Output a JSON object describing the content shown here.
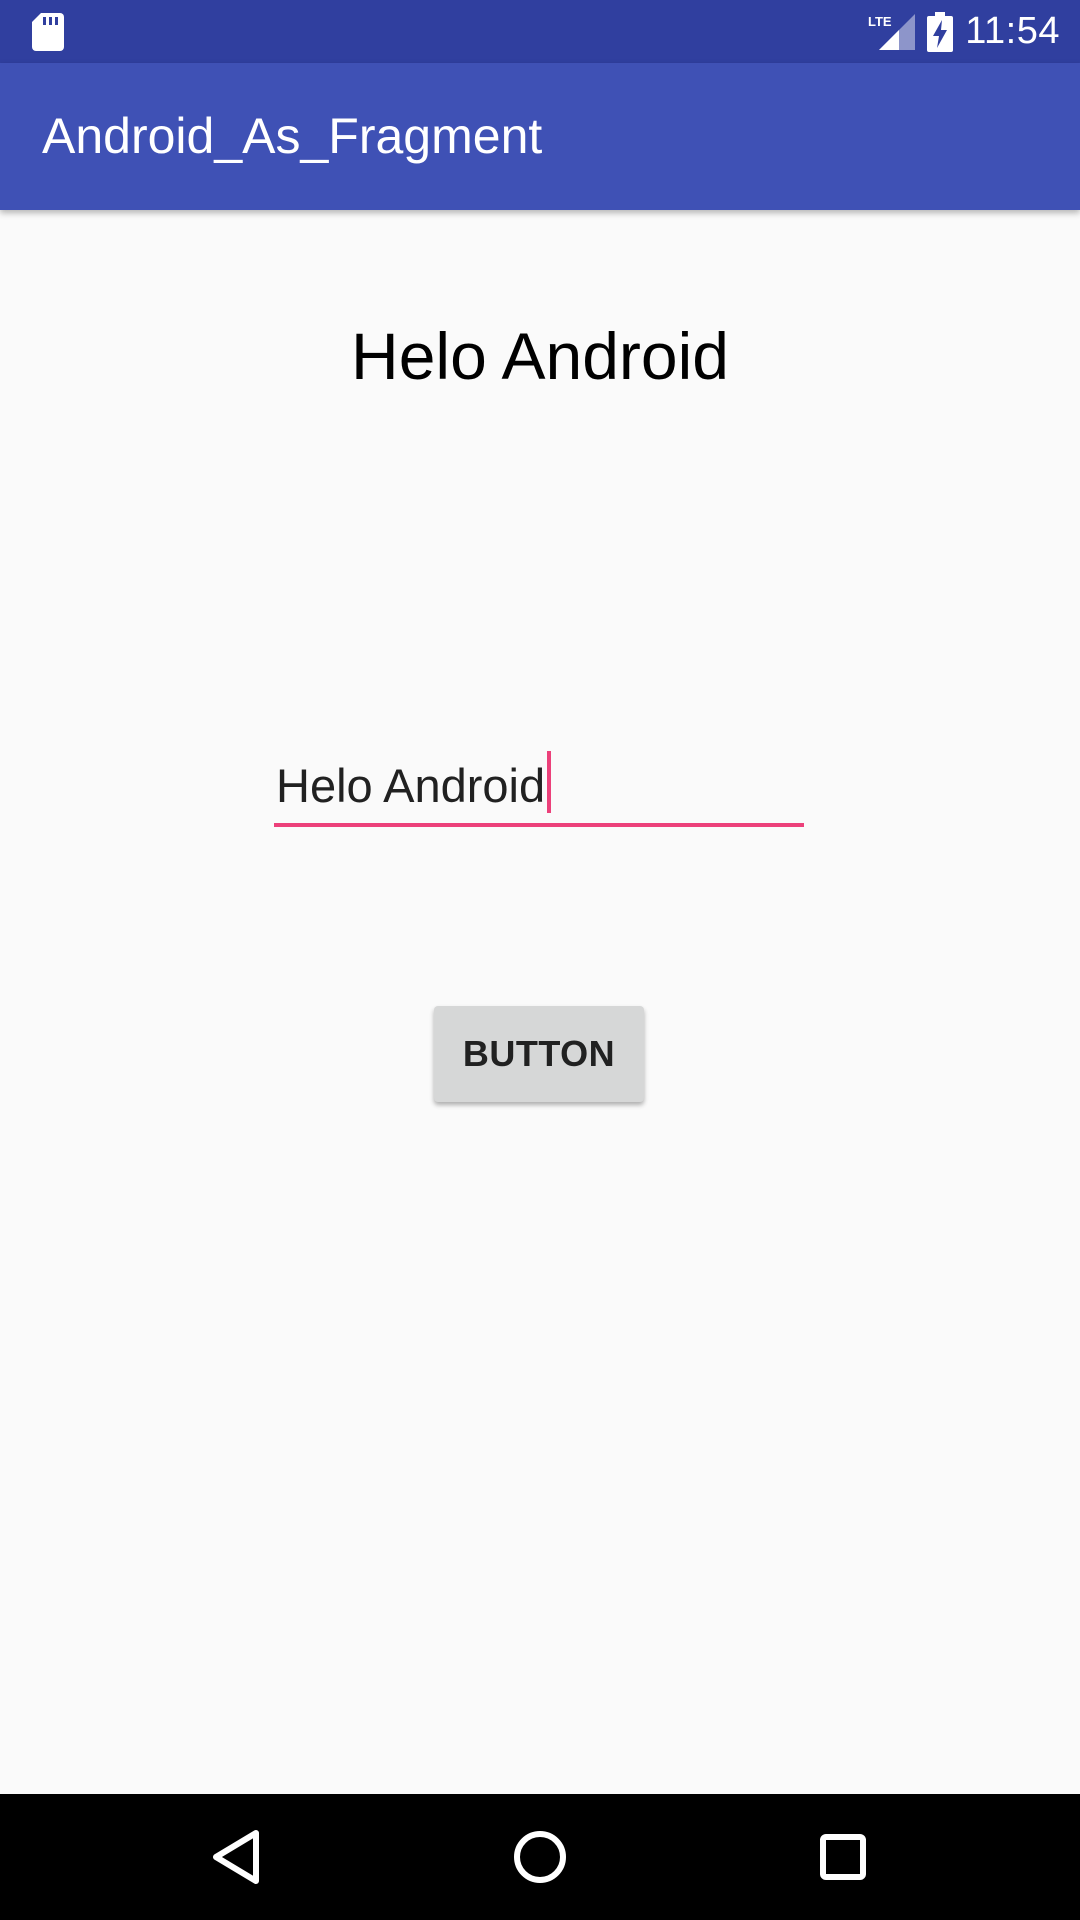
{
  "status_bar": {
    "time": "11:54",
    "network_label": "LTE",
    "icons": [
      "sd-card-icon",
      "lte-signal-icon",
      "battery-charging-icon"
    ]
  },
  "app_bar": {
    "title": "Android_As_Fragment"
  },
  "main": {
    "heading": "Helo Android",
    "input_value": "Helo Android",
    "button_label": "BUTTON"
  },
  "nav_bar": {
    "icons": [
      "back-icon",
      "home-icon",
      "recents-icon"
    ]
  },
  "colors": {
    "status_bar": "#303f9f",
    "app_bar": "#3f51b5",
    "accent": "#ec407a",
    "background": "#fafafa",
    "button": "#d6d7d7"
  }
}
